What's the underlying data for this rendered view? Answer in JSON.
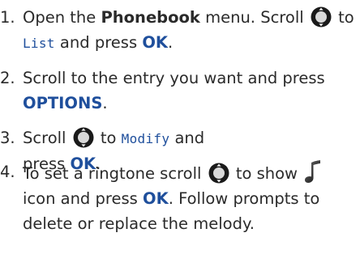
{
  "steps": [
    {
      "num": "1.",
      "t1": "Open the ",
      "t2": "Phonebook",
      "t3": " menu. Scroll",
      "t4": "to",
      "t5": "List",
      "t6": " and press ",
      "t7": "OK",
      "t8": "."
    },
    {
      "num": "2.",
      "t1": "Scroll to the entry you want and press",
      "t2": "OPTIONS",
      "t3": "."
    },
    {
      "num": "3.",
      "t1": "Scroll",
      "t2": "to ",
      "t3": "Modify",
      "t4": " and",
      "t5": "press ",
      "t6": "OK",
      "t7": "."
    },
    {
      "num": "4.",
      "t1": "To set a ringtone scroll",
      "t2": "to show",
      "t3": "icon and press ",
      "t4": "OK",
      "t5": ". Follow prompts to",
      "t6": "delete or replace the melody."
    }
  ],
  "icons": {
    "nav": "navigation-key-icon",
    "ringtone": "ringtone-note-icon"
  },
  "colors": {
    "text": "#2a2a2a",
    "accent": "#1f4f9c"
  }
}
